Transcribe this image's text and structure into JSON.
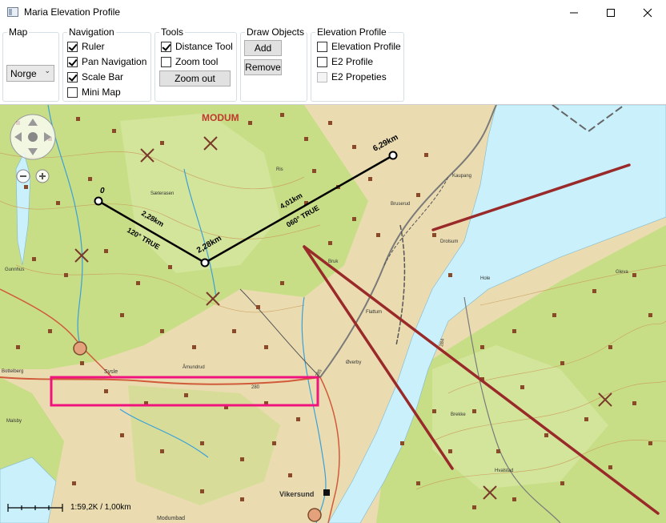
{
  "window": {
    "title": "Maria Elevation Profile"
  },
  "ribbon": {
    "map": {
      "title": "Map",
      "selected": "Norge"
    },
    "navigation": {
      "title": "Navigation",
      "items": [
        {
          "label": "Ruler",
          "checked": true
        },
        {
          "label": "Pan Navigation",
          "checked": true
        },
        {
          "label": "Scale Bar",
          "checked": true
        },
        {
          "label": "Mini Map",
          "checked": false
        }
      ]
    },
    "tools": {
      "title": "Tools",
      "distance_label": "Distance Tool",
      "zoom_label": "Zoom tool",
      "zoom_out_label": "Zoom out"
    },
    "draw_objects": {
      "title": "Draw Objects",
      "add_label": "Add",
      "remove_label": "Remove"
    },
    "elevation": {
      "title": "Elevation Profile",
      "profile_label": "Elevation Profile",
      "e2_label": "E2 Profile",
      "e2_props_label": "E2 Propeties"
    }
  },
  "map": {
    "ruler": {
      "p0": "0",
      "p1": "2,28km",
      "p2": "6,29km",
      "seg1_distance": "2,28km",
      "seg1_bearing": "120° TRUE",
      "seg2_distance": "4,01km",
      "seg2_bearing": "060° TRUE"
    },
    "labels": {
      "town": "MODUM",
      "vikersund": "Vikersund",
      "sysle": "Sysle",
      "saeterasen": "Sæterasen",
      "amundrud": "Åmundrud",
      "overby": "Øverby",
      "flattum": "Flattum",
      "drolsum": "Drolsum",
      "bruk": "Bruk",
      "brekke": "Brekke",
      "hole": "Hole",
      "hvalstad": "Hvalstad",
      "kaupang": "Kaupang",
      "bruserud": "Bruserud",
      "gunnhus": "Gunnhus",
      "bottelberg": "Bottelberg",
      "malsby": "Malsby",
      "gleva": "Gleva",
      "modumbad": "Modumbad",
      "road_280": "280",
      "road_285": "285",
      "road_284": "284",
      "road_ris": "Ris"
    },
    "scale_text": "1:59,2K / 1,00km"
  },
  "colors": {
    "water": "#c9f0fb",
    "forest": "#c7de87",
    "land": "#eadcb0",
    "route": "#9a2a2a",
    "highlight": "#f0127d",
    "building": "#8a4a2a"
  },
  "icons": [
    "app-icon",
    "minimize-icon",
    "maximize-icon",
    "close-icon",
    "pan-compass-icon",
    "zoom-out-icon",
    "zoom-in-icon",
    "dropdown-chevron-icon"
  ]
}
